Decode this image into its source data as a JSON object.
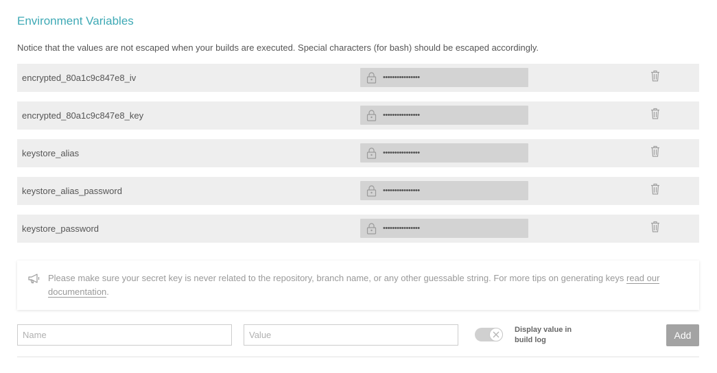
{
  "title": "Environment Variables",
  "notice": "Notice that the values are not escaped when your builds are executed. Special characters (for bash) should be escaped accordingly.",
  "variables": [
    {
      "name": "encrypted_80a1c9c847e8_iv",
      "value": "••••••••••••••••"
    },
    {
      "name": "encrypted_80a1c9c847e8_key",
      "value": "••••••••••••••••"
    },
    {
      "name": "keystore_alias",
      "value": "••••••••••••••••"
    },
    {
      "name": "keystore_alias_password",
      "value": "••••••••••••••••"
    },
    {
      "name": "keystore_password",
      "value": "••••••••••••••••"
    }
  ],
  "tip": {
    "text": "Please make sure your secret key is never related to the repository, branch name, or any other guessable string. For more tips on generating keys ",
    "link_text": "read our documentation",
    "suffix": "."
  },
  "form": {
    "name_placeholder": "Name",
    "value_placeholder": "Value",
    "toggle_label": "Display value in build log",
    "add_label": "Add"
  },
  "colors": {
    "title": "#3ea9b5",
    "row_bg": "#eeeeee",
    "value_bg": "#d3d3d3",
    "add_button_bg": "#a3a3a3"
  },
  "icons": [
    "lock-icon",
    "trash-icon",
    "megaphone-icon",
    "close-icon"
  ]
}
